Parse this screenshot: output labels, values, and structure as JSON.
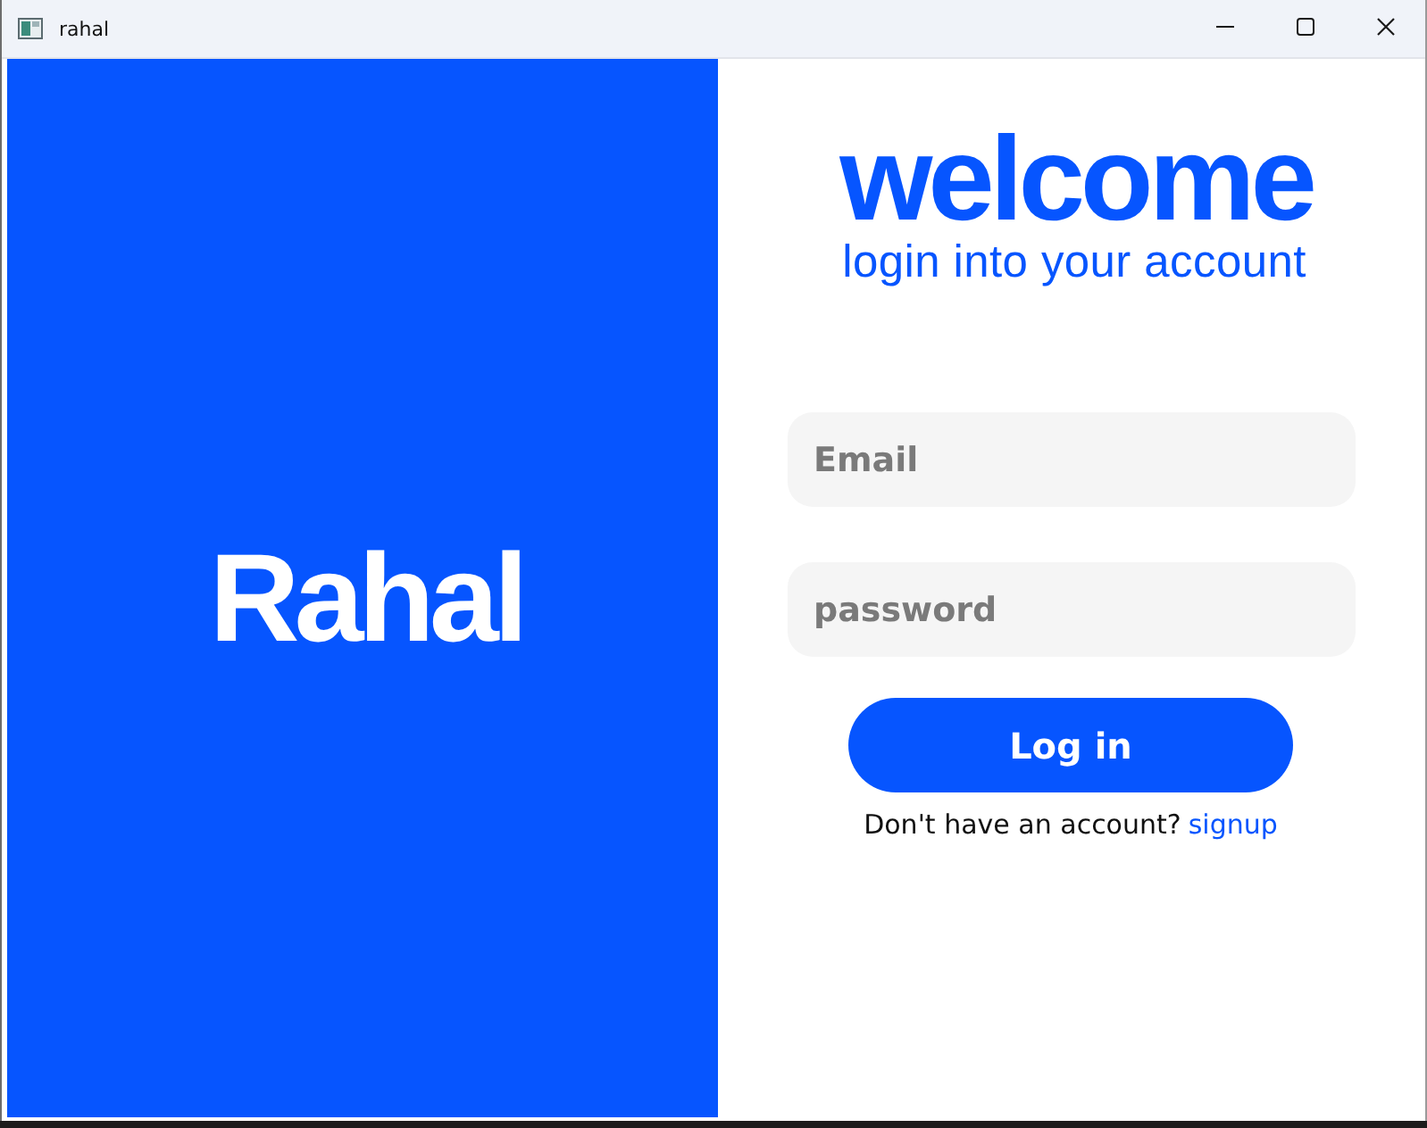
{
  "window": {
    "title": "rahal"
  },
  "brand_panel": {
    "name": "Rahal"
  },
  "login": {
    "heading": "welcome",
    "subheading": "login into your account",
    "fields": [
      {
        "placeholder": "Email"
      },
      {
        "placeholder": "password"
      }
    ],
    "submit_button": "Log in",
    "signup_prompt": "Don't have an account?",
    "signup_link": "signup"
  }
}
